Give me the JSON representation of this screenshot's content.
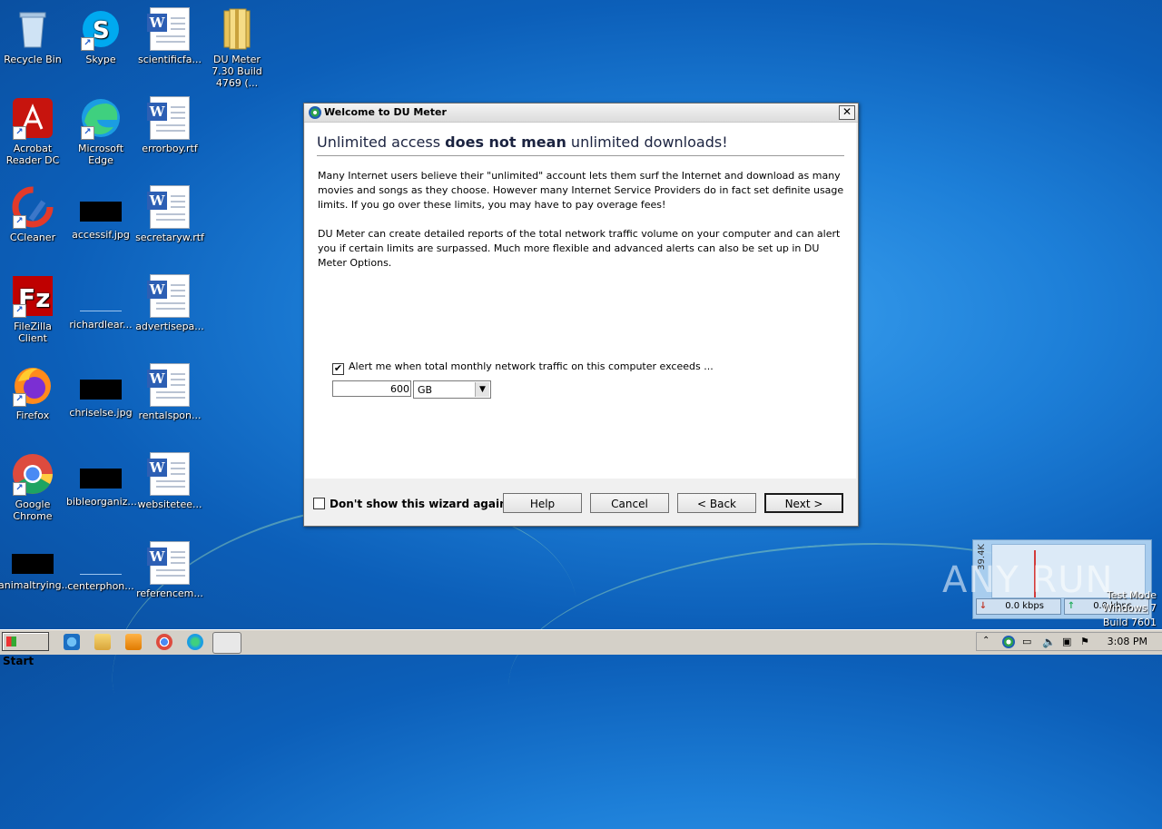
{
  "desktop": {
    "icons": [
      {
        "label": "Recycle Bin"
      },
      {
        "label": "Skype"
      },
      {
        "label": "scientificfa..."
      },
      {
        "label": "DU Meter 7.30 Build 4769 (..."
      },
      {
        "label": "Acrobat Reader DC"
      },
      {
        "label": "Microsoft Edge"
      },
      {
        "label": "errorboy.rtf"
      },
      {
        "label": "CCleaner"
      },
      {
        "label": "accessif.jpg"
      },
      {
        "label": "secretaryw.rtf"
      },
      {
        "label": "FileZilla Client"
      },
      {
        "label": "richardlear..."
      },
      {
        "label": "advertisepa..."
      },
      {
        "label": "Firefox"
      },
      {
        "label": "chriselse.jpg"
      },
      {
        "label": "rentalspon..."
      },
      {
        "label": "Google Chrome"
      },
      {
        "label": "bibleorganiz..."
      },
      {
        "label": "websitetee..."
      },
      {
        "label": "animaltrying..."
      },
      {
        "label": "centerphon..."
      },
      {
        "label": "referencem..."
      }
    ]
  },
  "dialog": {
    "title": "Welcome to DU Meter",
    "heading_pre": "Unlimited access ",
    "heading_bold": "does not mean",
    "heading_post": " unlimited downloads!",
    "paragraph1": "Many Internet users believe their \"unlimited\" account lets them surf the Internet and download as many movies and songs as they choose. However many Internet Service Providers do in fact set definite usage limits. If you go over these limits, you may have to pay overage fees!",
    "paragraph2": "DU Meter can create detailed reports of the total network traffic volume on your computer and can alert you if certain limits are surpassed. Much more flexible and advanced alerts can also be set up in DU Meter Options.",
    "alert_checkbox_label": "Alert me when total monthly network traffic on this computer exceeds ...",
    "alert_checked": true,
    "limit_value": "600",
    "limit_unit": "GB",
    "dont_show_label": "Don't show this wizard again",
    "dont_show_checked": false,
    "buttons": {
      "help": "Help",
      "cancel": "Cancel",
      "back": "< Back",
      "next": "Next >"
    }
  },
  "du_widget": {
    "axis_label": "39.4K",
    "download_rate": "0.0 kbps",
    "upload_rate": "0.0 kbps"
  },
  "watermark": "ANY RUN",
  "windows_info": {
    "line1": "Test Mode",
    "line2": "Windows 7",
    "line3": "Build 7601"
  },
  "taskbar": {
    "start_label": "Start",
    "clock": "3:08 PM"
  },
  "colors": {
    "desktop_bg": "#1d7fd8",
    "dialog_bg": "#f0f0f0",
    "taskbar_bg": "#d4d0c8"
  }
}
